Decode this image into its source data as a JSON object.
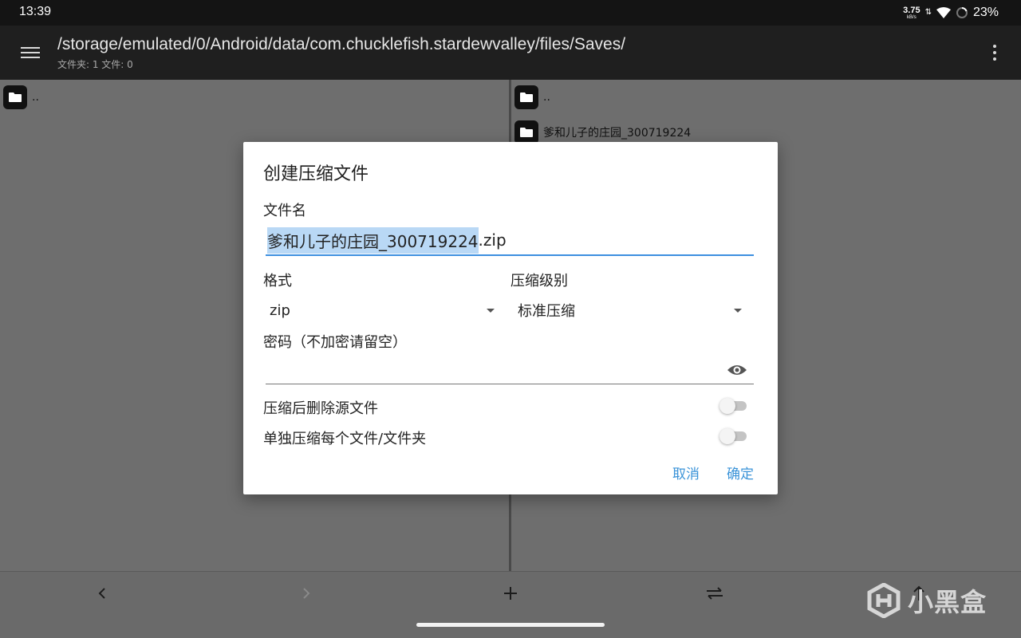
{
  "status_bar": {
    "time": "13:39",
    "net_speed": "3.75",
    "net_unit": "kB/s",
    "battery": "23%"
  },
  "app_bar": {
    "path": "/storage/emulated/0/Android/data/com.chucklefish.stardewvalley/files/Saves/",
    "summary": "文件夹: 1  文件: 0",
    "icons": [
      "menu-icon",
      "more-vert-icon"
    ]
  },
  "left_pane": {
    "items": [
      {
        "name": "..",
        "icon": "folder-icon"
      }
    ]
  },
  "right_pane": {
    "items": [
      {
        "name": "..",
        "icon": "folder-icon"
      },
      {
        "name": "爹和儿子的庄园_300719224",
        "icon": "folder-icon"
      }
    ]
  },
  "dialog": {
    "title": "创建压缩文件",
    "filename_label": "文件名",
    "filename_selected": "爹和儿子的庄园_300719224",
    "filename_ext": ".zip",
    "format_label": "格式",
    "format_value": "zip",
    "level_label": "压缩级别",
    "level_value": "标准压缩",
    "password_label": "密码（不加密请留空）",
    "password_value": "",
    "delete_source_label": "压缩后删除源文件",
    "delete_source_on": false,
    "separate_label": "单独压缩每个文件/文件夹",
    "separate_on": false,
    "cancel_label": "取消",
    "ok_label": "确定",
    "accent_color": "#3a93d8"
  },
  "watermark": {
    "text": "小黑盒"
  }
}
